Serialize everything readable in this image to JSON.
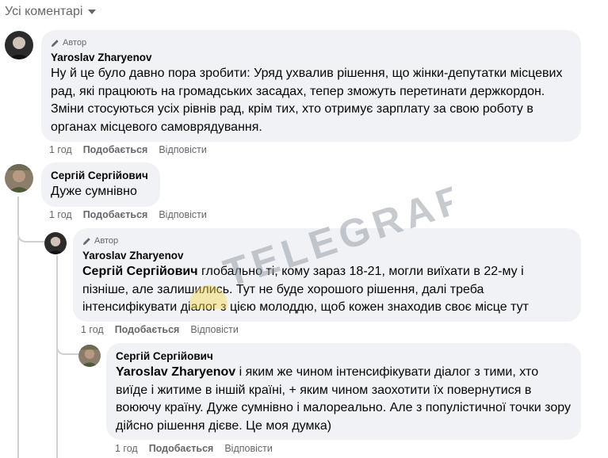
{
  "header": {
    "title": "Усі коментарі",
    "chevron_icon": "chevron-down-icon"
  },
  "comments": [
    {
      "badge": "Автор",
      "author": "Yaroslav Zharyenov",
      "text": "Ну й це було давно пора зробити: Уряд ухвалив рішення, що жінки-депутатки місцевих рад, які працюють на громадських засадах, тепер зможуть перетинати держкордон. Зміни стосуються усіх рівнів рад, крім тих, хто отримує зарплату за свою роботу в органах місцевого самоврядування.",
      "time": "1 год",
      "like": "Подобається",
      "reply": "Відповісти"
    },
    {
      "author": "Сергій Сергійович",
      "text": "Дуже сумнівно",
      "time": "1 год",
      "like": "Подобається",
      "reply": "Відповісти"
    },
    {
      "badge": "Автор",
      "author": "Yaroslav Zharyenov",
      "mention": "Сергій Сергійович",
      "text": " глобально ті, кому зараз 18-21, могли виїхати в 22-му і пізніше, але залишились. Тут не буде хорошого рішення, далі треба інтенсифікувати діалог з цією молоддю, щоб кожен знаходив своє місце тут",
      "time": "1 год",
      "like": "Подобається",
      "reply": "Відповісти"
    },
    {
      "author": "Сергій Сергійович",
      "mention": "Yaroslav Zharyenov",
      "text": " і яким же чином інтенсифікувати діалог з тими, хто виїде і житиме в іншій країні, + яким чином заохотити їх повернутися в воюючу країну. Дуже сумнівно і малореально. Але з популістичної точки зору дійсно рішення дієве. Це моя думка)",
      "time": "1 год",
      "like": "Подобається",
      "reply": "Відповісти"
    }
  ],
  "watermark": {
    "text": "TELEGRAF",
    "color": "#9aa1ab",
    "accent": "#f7d94c"
  }
}
